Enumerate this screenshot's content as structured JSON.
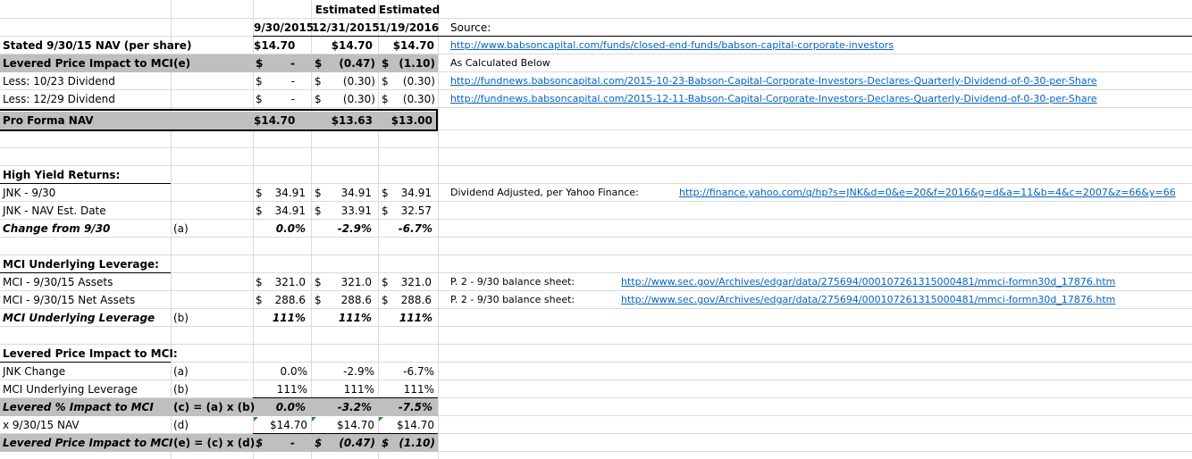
{
  "header": {
    "estimated_1": "Estimated",
    "estimated_2": "Estimated",
    "date_1": "9/30/2015",
    "date_2": "12/31/2015",
    "date_3": "1/19/2016",
    "source_label": "Source:"
  },
  "nav_section": {
    "stated_nav": {
      "label": "Stated 9/30/15 NAV (per share)",
      "v1": "$14.70",
      "v2": "$14.70",
      "v3": "$14.70",
      "source": "http://www.babsoncapital.com/funds/closed-end-funds/babson-capital-corporate-investors"
    },
    "levered_impact": {
      "label": "Levered Price  Impact to MCI",
      "ref": "(e)",
      "v1": "-",
      "v2": "(0.47)",
      "v3": "(1.10)",
      "note": "As Calculated Below"
    },
    "dividend_1": {
      "label": "Less: 10/23 Dividend",
      "v1": "-",
      "v2": "(0.30)",
      "v3": "(0.30)",
      "source": "http://fundnews.babsoncapital.com/2015-10-23-Babson-Capital-Corporate-Investors-Declares-Quarterly-Dividend-of-0-30-per-Share"
    },
    "dividend_2": {
      "label": "Less: 12/29 Dividend",
      "v1": "-",
      "v2": "(0.30)",
      "v3": "(0.30)",
      "source": "http://fundnews.babsoncapital.com/2015-12-11-Babson-Capital-Corporate-Investors-Declares-Quarterly-Dividend-of-0-30-per-Share"
    },
    "pro_forma": {
      "label": "Pro Forma NAV",
      "v1": "$14.70",
      "v2": "$13.63",
      "v3": "$13.00"
    }
  },
  "high_yield": {
    "title": "High Yield Returns:",
    "jnk_930": {
      "label": "JNK - 9/30",
      "v1": "34.91",
      "v2": "34.91",
      "v3": "34.91",
      "note": "Dividend Adjusted, per Yahoo Finance:",
      "source": "http://finance.yahoo.com/q/hp?s=JNK&d=0&e=20&f=2016&g=d&a=11&b=4&c=2007&z=66&y=66"
    },
    "jnk_nav": {
      "label": "JNK - NAV Est. Date",
      "v1": "34.91",
      "v2": "33.91",
      "v3": "32.57"
    },
    "change": {
      "label": "Change from 9/30",
      "ref": "(a)",
      "v1": "0.0%",
      "v2": "-2.9%",
      "v3": "-6.7%"
    }
  },
  "leverage": {
    "title": "MCI Underlying Leverage:",
    "assets": {
      "label": "MCI - 9/30/15 Assets",
      "v1": "321.0",
      "v2": "321.0",
      "v3": "321.0",
      "note": "P. 2 - 9/30 balance sheet:",
      "source": "http://www.sec.gov/Archives/edgar/data/275694/000107261315000481/mmci-formn30d_17876.htm"
    },
    "net_assets": {
      "label": "MCI - 9/30/15 Net Assets",
      "v1": "288.6",
      "v2": "288.6",
      "v3": "288.6",
      "note": "P. 2 - 9/30 balance sheet:",
      "source": "http://www.sec.gov/Archives/edgar/data/275694/000107261315000481/mmci-formn30d_17876.htm"
    },
    "underlying": {
      "label": "MCI Underlying Leverage",
      "ref": "(b)",
      "v1": "111%",
      "v2": "111%",
      "v3": "111%"
    }
  },
  "impact": {
    "title": "Levered Price Impact to MCI:",
    "jnk_change": {
      "label": "JNK Change",
      "ref": "(a)",
      "v1": "0.0%",
      "v2": "-2.9%",
      "v3": "-6.7%"
    },
    "leverage": {
      "label": "MCI Underlying Leverage",
      "ref": "(b)",
      "v1": "111%",
      "v2": "111%",
      "v3": "111%"
    },
    "levered_pct": {
      "label": "Levered % Impact to MCI",
      "ref": "(c) = (a) x (b)",
      "v1": "0.0%",
      "v2": "-3.2%",
      "v3": "-7.5%"
    },
    "nav": {
      "label": "x 9/30/15 NAV",
      "ref": "(d)",
      "v1": "$14.70",
      "v2": "$14.70",
      "v3": "$14.70"
    },
    "levered_price": {
      "label": "Levered Price  Impact to MCI",
      "ref": "(e) = (c) x (d)",
      "v1": "-",
      "v2": "(0.47)",
      "v3": "(1.10)"
    }
  },
  "symbols": {
    "dollar": "$"
  }
}
